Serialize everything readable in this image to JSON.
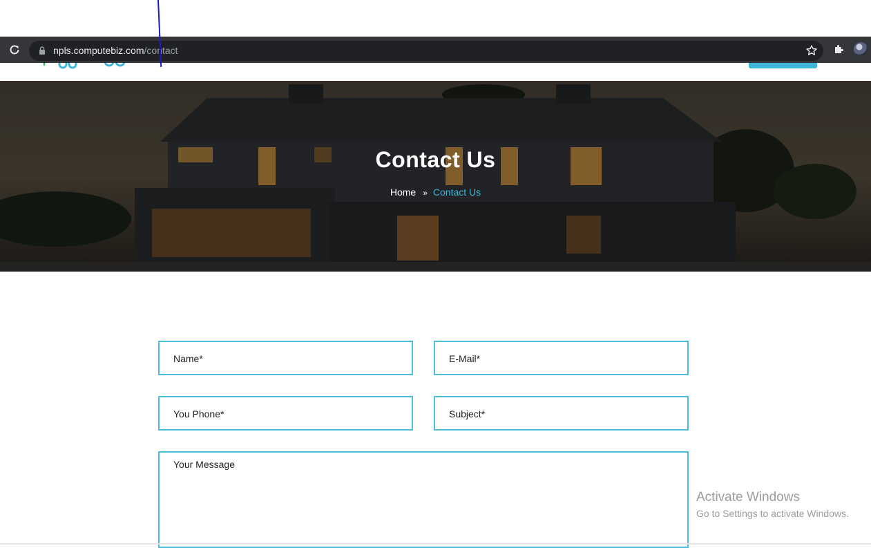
{
  "browser": {
    "url_host": "npls.computebiz.com",
    "url_path": "/contact"
  },
  "hero": {
    "title": "Contact Us",
    "breadcrumb": {
      "home": "Home",
      "separator": "»",
      "current": "Contact Us"
    }
  },
  "form": {
    "name_placeholder": "Name*",
    "email_placeholder": "E-Mail*",
    "phone_placeholder": "You Phone*",
    "subject_placeholder": "Subject*",
    "message_placeholder": "Your Message"
  },
  "watermark": {
    "title": "Activate Windows",
    "subtitle": "Go to Settings to activate Windows."
  },
  "colors": {
    "accent": "#3eb6d8",
    "field_border": "#4ebcdc",
    "browser_bar": "#35363a"
  },
  "icons": [
    "reload-icon",
    "lock-icon",
    "star-icon",
    "extensions-icon",
    "chevron-right-icon"
  ]
}
